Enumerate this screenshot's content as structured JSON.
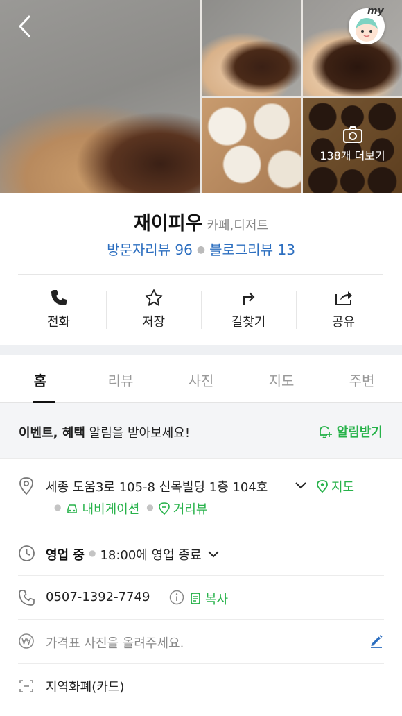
{
  "header": {
    "photo_more_label": "138개 더보기",
    "my_label": "my"
  },
  "place": {
    "name": "재이피우",
    "category": "카페,디저트",
    "visitor_review_label": "방문자리뷰 96",
    "blog_review_label": "블로그리뷰 13"
  },
  "actions": [
    {
      "label": "전화",
      "icon": "phone-icon"
    },
    {
      "label": "저장",
      "icon": "star-icon"
    },
    {
      "label": "길찾기",
      "icon": "directions-icon"
    },
    {
      "label": "공유",
      "icon": "share-icon"
    }
  ],
  "tabs": [
    {
      "label": "홈",
      "active": true
    },
    {
      "label": "리뷰",
      "active": false
    },
    {
      "label": "사진",
      "active": false
    },
    {
      "label": "지도",
      "active": false
    },
    {
      "label": "주변",
      "active": false
    }
  ],
  "alert": {
    "text_bold": "이벤트, 혜택",
    "text_rest": " 알림을 받아보세요!",
    "button_label": "알림받기"
  },
  "info": {
    "address": "세종 도움3로 105-8 신목빌딩 1층 104호",
    "map_label": "지도",
    "navigation_label": "내비게이션",
    "street_view_label": "거리뷰",
    "status": "영업 중",
    "hours_text": "18:00에 영업 종료",
    "phone": "0507-1392-7749",
    "copy_label": "복사",
    "price_placeholder": "가격표 사진을 올려주세요.",
    "payment": "지역화폐(카드)"
  },
  "colors": {
    "accent_green": "#27b24a",
    "link_blue": "#2d6fc0"
  }
}
